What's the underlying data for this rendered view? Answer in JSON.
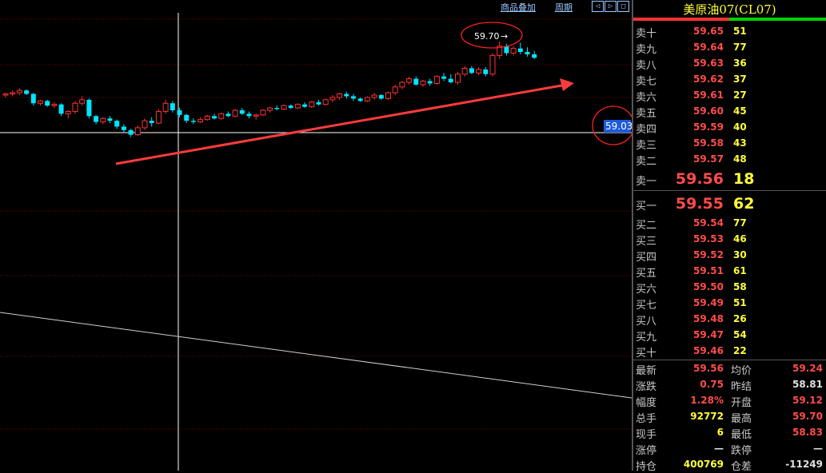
{
  "toolbar": {
    "overlay_label": "商品叠加",
    "cycle_label": "周期",
    "btn_left": "◁",
    "btn_right": "▷",
    "btn_box": "□"
  },
  "chart": {
    "high_marker": "59.70",
    "last_price_tag": "59.03",
    "colors": {
      "up": "#ff3232",
      "down": "#00e5ff",
      "grid": "#7a0000",
      "arrow": "#ff3c3c",
      "tag_bg": "#1e5adc"
    }
  },
  "chart_data": {
    "type": "candlestick",
    "ylim": [
      58.0,
      59.85
    ],
    "candles": [
      [
        59.24,
        59.26,
        59.22,
        59.25
      ],
      [
        59.25,
        59.28,
        59.23,
        59.26
      ],
      [
        59.26,
        59.3,
        59.24,
        59.28
      ],
      [
        59.28,
        59.29,
        59.24,
        59.25
      ],
      [
        59.25,
        59.26,
        59.15,
        59.17
      ],
      [
        59.17,
        59.2,
        59.15,
        59.19
      ],
      [
        59.19,
        59.2,
        59.14,
        59.15
      ],
      [
        59.15,
        59.18,
        59.13,
        59.16
      ],
      [
        59.16,
        59.17,
        59.06,
        59.08
      ],
      [
        59.08,
        59.11,
        59.04,
        59.1
      ],
      [
        59.1,
        59.19,
        59.08,
        59.17
      ],
      [
        59.17,
        59.23,
        59.15,
        59.2
      ],
      [
        59.2,
        59.21,
        59.04,
        59.06
      ],
      [
        59.06,
        59.07,
        58.99,
        59.01
      ],
      [
        59.01,
        59.05,
        58.99,
        59.04
      ],
      [
        59.04,
        59.06,
        59.0,
        59.02
      ],
      [
        59.02,
        59.03,
        58.95,
        58.97
      ],
      [
        58.97,
        58.99,
        58.92,
        58.94
      ],
      [
        58.94,
        58.95,
        58.88,
        58.9
      ],
      [
        58.9,
        58.98,
        58.89,
        58.96
      ],
      [
        58.96,
        59.04,
        58.94,
        59.02
      ],
      [
        59.02,
        59.05,
        58.97,
        59.0
      ],
      [
        59.0,
        59.12,
        58.99,
        59.1
      ],
      [
        59.1,
        59.2,
        59.08,
        59.17
      ],
      [
        59.17,
        59.19,
        59.09,
        59.11
      ],
      [
        59.11,
        59.13,
        59.05,
        59.07
      ],
      [
        59.07,
        59.08,
        59.0,
        59.02
      ],
      [
        59.02,
        59.04,
        58.99,
        59.01
      ],
      [
        59.01,
        59.05,
        59.0,
        59.03
      ],
      [
        59.03,
        59.07,
        59.02,
        59.06
      ],
      [
        59.06,
        59.08,
        59.03,
        59.04
      ],
      [
        59.04,
        59.09,
        59.03,
        59.08
      ],
      [
        59.08,
        59.1,
        59.05,
        59.06
      ],
      [
        59.06,
        59.12,
        59.05,
        59.11
      ],
      [
        59.11,
        59.13,
        59.07,
        59.08
      ],
      [
        59.08,
        59.1,
        59.04,
        59.06
      ],
      [
        59.06,
        59.08,
        59.03,
        59.07
      ],
      [
        59.07,
        59.12,
        59.06,
        59.11
      ],
      [
        59.11,
        59.14,
        59.09,
        59.13
      ],
      [
        59.13,
        59.15,
        59.11,
        59.12
      ],
      [
        59.12,
        59.16,
        59.11,
        59.15
      ],
      [
        59.15,
        59.16,
        59.12,
        59.13
      ],
      [
        59.13,
        59.17,
        59.12,
        59.16
      ],
      [
        59.16,
        59.18,
        59.13,
        59.14
      ],
      [
        59.14,
        59.19,
        59.13,
        59.18
      ],
      [
        59.18,
        59.2,
        59.15,
        59.16
      ],
      [
        59.16,
        59.21,
        59.15,
        59.2
      ],
      [
        59.2,
        59.24,
        59.18,
        59.22
      ],
      [
        59.22,
        59.26,
        59.2,
        59.25
      ],
      [
        59.25,
        59.27,
        59.21,
        59.23
      ],
      [
        59.23,
        59.25,
        59.19,
        59.21
      ],
      [
        59.21,
        59.22,
        59.18,
        59.19
      ],
      [
        59.19,
        59.23,
        59.18,
        59.22
      ],
      [
        59.22,
        59.26,
        59.2,
        59.24
      ],
      [
        59.24,
        59.25,
        59.2,
        59.21
      ],
      [
        59.21,
        59.27,
        59.2,
        59.26
      ],
      [
        59.26,
        59.33,
        59.24,
        59.31
      ],
      [
        59.31,
        59.36,
        59.29,
        59.35
      ],
      [
        59.35,
        59.4,
        59.33,
        59.38
      ],
      [
        59.38,
        59.4,
        59.32,
        59.33
      ],
      [
        59.33,
        59.37,
        59.31,
        59.36
      ],
      [
        59.36,
        59.38,
        59.32,
        59.34
      ],
      [
        59.34,
        59.41,
        59.33,
        59.4
      ],
      [
        59.4,
        59.43,
        59.36,
        59.38
      ],
      [
        59.38,
        59.42,
        59.34,
        59.35
      ],
      [
        59.35,
        59.44,
        59.33,
        59.42
      ],
      [
        59.42,
        59.49,
        59.4,
        59.47
      ],
      [
        59.47,
        59.49,
        59.42,
        59.43
      ],
      [
        59.43,
        59.48,
        59.41,
        59.46
      ],
      [
        59.46,
        59.48,
        59.4,
        59.42
      ],
      [
        59.42,
        59.6,
        59.4,
        59.58
      ],
      [
        59.58,
        59.7,
        59.55,
        59.66
      ],
      [
        59.66,
        59.68,
        59.58,
        59.6
      ],
      [
        59.6,
        59.66,
        59.58,
        59.64
      ],
      [
        59.64,
        59.69,
        59.59,
        59.61
      ],
      [
        59.61,
        59.65,
        59.57,
        59.59
      ],
      [
        59.59,
        59.62,
        59.55,
        59.56
      ]
    ]
  },
  "panel": {
    "title": "美原油07(CL07)",
    "asks": [
      {
        "label": "卖十",
        "price": "59.65",
        "vol": "51"
      },
      {
        "label": "卖九",
        "price": "59.64",
        "vol": "77"
      },
      {
        "label": "卖八",
        "price": "59.63",
        "vol": "36"
      },
      {
        "label": "卖七",
        "price": "59.62",
        "vol": "37"
      },
      {
        "label": "卖六",
        "price": "59.61",
        "vol": "27"
      },
      {
        "label": "卖五",
        "price": "59.60",
        "vol": "45"
      },
      {
        "label": "卖四",
        "price": "59.59",
        "vol": "40"
      },
      {
        "label": "卖三",
        "price": "59.58",
        "vol": "43"
      },
      {
        "label": "卖二",
        "price": "59.57",
        "vol": "48"
      }
    ],
    "ask1": {
      "label": "卖一",
      "price": "59.56",
      "vol": "18"
    },
    "bid1": {
      "label": "买一",
      "price": "59.55",
      "vol": "62"
    },
    "bids": [
      {
        "label": "买二",
        "price": "59.54",
        "vol": "77"
      },
      {
        "label": "买三",
        "price": "59.53",
        "vol": "46"
      },
      {
        "label": "买四",
        "price": "59.52",
        "vol": "30"
      },
      {
        "label": "买五",
        "price": "59.51",
        "vol": "61"
      },
      {
        "label": "买六",
        "price": "59.50",
        "vol": "58"
      },
      {
        "label": "买七",
        "price": "59.49",
        "vol": "51"
      },
      {
        "label": "买八",
        "price": "59.48",
        "vol": "26"
      },
      {
        "label": "买九",
        "price": "59.47",
        "vol": "54"
      },
      {
        "label": "买十",
        "price": "59.46",
        "vol": "22"
      }
    ],
    "stats": [
      {
        "l1": "最新",
        "v1": "59.56",
        "c1": "#ff4c4c",
        "l2": "均价",
        "v2": "59.24",
        "c2": "#ff4c4c"
      },
      {
        "l1": "涨跌",
        "v1": "0.75",
        "c1": "#ff4c4c",
        "l2": "昨结",
        "v2": "58.81",
        "c2": "#e0e0e0"
      },
      {
        "l1": "幅度",
        "v1": "1.28%",
        "c1": "#ff4c4c",
        "l2": "开盘",
        "v2": "59.12",
        "c2": "#ff4c4c"
      },
      {
        "l1": "总手",
        "v1": "92772",
        "c1": "#ffff3c",
        "l2": "最高",
        "v2": "59.70",
        "c2": "#ff4c4c"
      },
      {
        "l1": "现手",
        "v1": "6",
        "c1": "#ffff3c",
        "l2": "最低",
        "v2": "58.83",
        "c2": "#ff4c4c"
      },
      {
        "l1": "涨停",
        "v1": "—",
        "c1": "#e0e0e0",
        "l2": "跌停",
        "v2": "—",
        "c2": "#e0e0e0"
      },
      {
        "l1": "持仓",
        "v1": "400769",
        "c1": "#ffff3c",
        "l2": "仓差",
        "v2": "-11249",
        "c2": "#e0e0e0"
      }
    ]
  }
}
